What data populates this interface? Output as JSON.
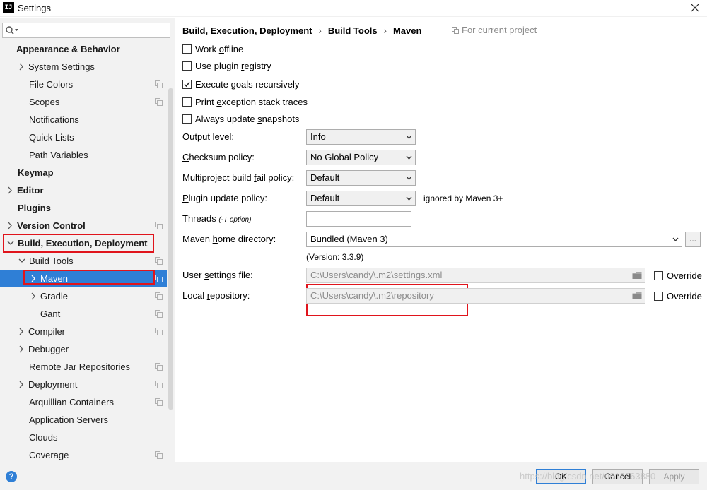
{
  "window": {
    "app_icon": "IJ",
    "title": "Settings"
  },
  "search": {
    "placeholder": "",
    "value": ""
  },
  "tree": [
    {
      "label": "Appearance & Behavior",
      "bold": true
    },
    {
      "label": "System Settings",
      "arrow": "right"
    },
    {
      "label": "File Colors",
      "proj": true
    },
    {
      "label": "Scopes",
      "proj": true
    },
    {
      "label": "Notifications"
    },
    {
      "label": "Quick Lists"
    },
    {
      "label": "Path Variables"
    },
    {
      "label": "Keymap",
      "bold": true
    },
    {
      "label": "Editor",
      "bold": true,
      "arrow": "right"
    },
    {
      "label": "Plugins",
      "bold": true
    },
    {
      "label": "Version Control",
      "bold": true,
      "arrow": "right",
      "proj": true
    },
    {
      "label": "Build, Execution, Deployment",
      "bold": true,
      "arrow": "down"
    },
    {
      "label": "Build Tools",
      "arrow": "down",
      "proj": true
    },
    {
      "label": "Maven",
      "arrow": "right",
      "proj": true,
      "selected": true
    },
    {
      "label": "Gradle",
      "arrow": "right",
      "proj": true
    },
    {
      "label": "Gant",
      "proj": true
    },
    {
      "label": "Compiler",
      "arrow": "right",
      "proj": true
    },
    {
      "label": "Debugger",
      "arrow": "right"
    },
    {
      "label": "Remote Jar Repositories",
      "proj": true
    },
    {
      "label": "Deployment",
      "arrow": "right",
      "proj": true
    },
    {
      "label": "Arquillian Containers",
      "proj": true
    },
    {
      "label": "Application Servers"
    },
    {
      "label": "Clouds"
    },
    {
      "label": "Coverage",
      "proj": true
    }
  ],
  "breadcrumb": [
    "Build, Execution, Deployment",
    "Build Tools",
    "Maven"
  ],
  "breadcrumb_sep": "›",
  "scope_label": "For current project",
  "checkboxes": [
    {
      "pre": "Work ",
      "mn": "o",
      "post": "ffline",
      "checked": false
    },
    {
      "pre": "Use plugin ",
      "mn": "r",
      "post": "egistry",
      "checked": false
    },
    {
      "pre": "Execute ",
      "mn": "g",
      "post": "oals recursively",
      "checked": true
    },
    {
      "pre": "Print ",
      "mn": "e",
      "post": "xception stack traces",
      "checked": false
    },
    {
      "pre": "Always update ",
      "mn": "s",
      "post": "napshots",
      "checked": false
    }
  ],
  "fields": {
    "output_level": {
      "pre": "Output ",
      "mn": "l",
      "post": "evel:",
      "value": "Info"
    },
    "checksum_policy": {
      "pre": "",
      "mn": "C",
      "post": "hecksum policy:",
      "value": "No Global Policy"
    },
    "multiproject_policy": {
      "pre": "Multiproject build ",
      "mn": "f",
      "post": "ail policy:",
      "value": "Default"
    },
    "plugin_update_policy": {
      "pre": "",
      "mn": "P",
      "post": "lugin update policy:",
      "value": "Default",
      "note": "ignored by Maven 3+"
    },
    "threads": {
      "label": "Threads",
      "hint": "(-T option)",
      "value": ""
    },
    "maven_home": {
      "pre": "Maven ",
      "mn": "h",
      "post": "ome directory:",
      "value": "Bundled (Maven 3)",
      "browse": "...",
      "version": "(Version: 3.3.9)"
    },
    "user_settings": {
      "pre": "User ",
      "mn": "s",
      "post": "ettings file:",
      "value": "C:\\Users\\candy\\.m2\\settings.xml",
      "override": "Override"
    },
    "local_repo": {
      "pre": "Local ",
      "mn": "r",
      "post": "epository:",
      "value": "C:\\Users\\candy\\.m2\\repository",
      "override": "Override"
    }
  },
  "footer": {
    "help": "?",
    "ok": "OK",
    "cancel": "Cancel",
    "apply": "Apply",
    "watermark": "https://blog.csdn.net/u012263880"
  },
  "colors": {
    "selection": "#2f7fd6",
    "highlight_box": "#e0141c"
  }
}
